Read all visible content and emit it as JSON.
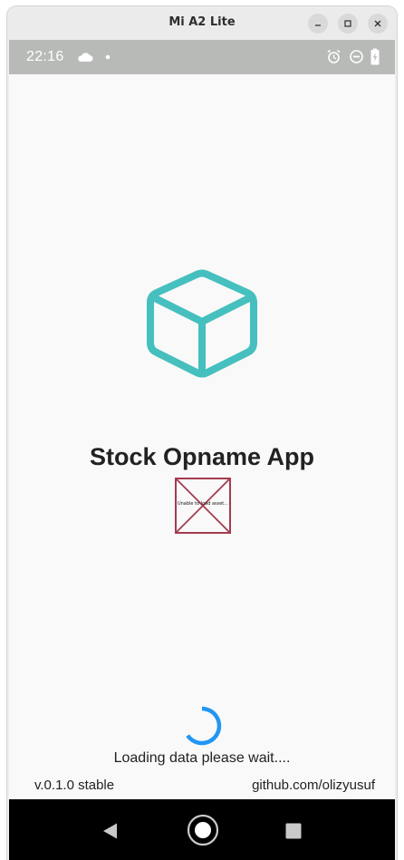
{
  "window": {
    "title": "Mi A2 Lite"
  },
  "status_bar": {
    "time": "22:16",
    "icons": [
      "cloud-icon",
      "dot-icon",
      "alarm-icon",
      "do-not-disturb-icon",
      "battery-charging-icon"
    ]
  },
  "app": {
    "logo_icon": "cube-icon",
    "title": "Stock Opname App",
    "broken_asset_text": "Unable to load asset...",
    "loading_text": "Loading data please wait....",
    "version": "v.0.1.0 stable",
    "author_link": "github.com/olizyusuf"
  },
  "nav_bar": {
    "buttons": [
      "back-icon",
      "home-icon",
      "recents-icon"
    ]
  },
  "colors": {
    "accent_teal": "#46bfbf",
    "spinner_blue": "#2196f3",
    "broken_asset_border": "#a53a50",
    "status_bar": "#b8bab8",
    "screen_background": "#f8f9f8"
  }
}
